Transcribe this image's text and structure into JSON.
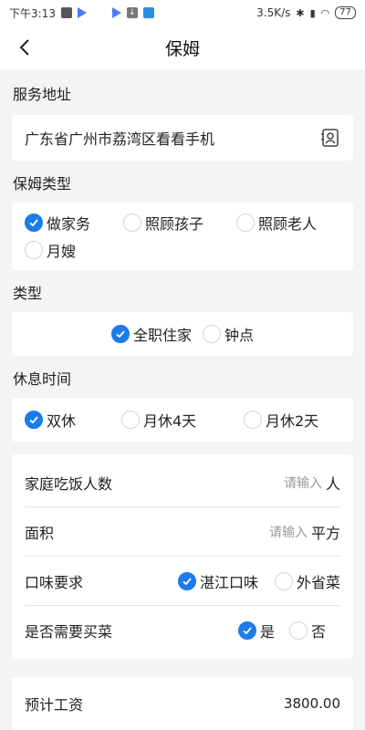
{
  "status": {
    "time": "下午3:13",
    "net_speed": "3.5K/s",
    "battery": "77"
  },
  "nav": {
    "title": "保姆"
  },
  "address": {
    "label": "服务地址",
    "value": "广东省广州市荔湾区看看手机"
  },
  "nanny_type": {
    "label": "保姆类型",
    "options": [
      {
        "text": "做家务",
        "checked": true
      },
      {
        "text": "照顾孩子",
        "checked": false
      },
      {
        "text": "照顾老人",
        "checked": false
      },
      {
        "text": "月嫂",
        "checked": false
      }
    ]
  },
  "type": {
    "label": "类型",
    "options": [
      {
        "text": "全职住家",
        "checked": true
      },
      {
        "text": "钟点",
        "checked": false
      }
    ]
  },
  "rest": {
    "label": "休息时间",
    "options": [
      {
        "text": "双休",
        "checked": true
      },
      {
        "text": "月休4天",
        "checked": false
      },
      {
        "text": "月休2天",
        "checked": false
      }
    ]
  },
  "form": {
    "diners": {
      "label": "家庭吃饭人数",
      "placeholder": "请输入",
      "unit": "人"
    },
    "area": {
      "label": "面积",
      "placeholder": "请输入",
      "unit": "平方"
    },
    "taste": {
      "label": "口味要求",
      "options": [
        {
          "text": "湛江口味",
          "checked": true
        },
        {
          "text": "外省菜",
          "checked": false
        }
      ]
    },
    "groceries": {
      "label": "是否需要买菜",
      "options": [
        {
          "text": "是",
          "checked": true
        },
        {
          "text": "否",
          "checked": false
        }
      ]
    }
  },
  "salary": {
    "label": "预计工资",
    "value": "3800.00"
  },
  "colors": {
    "accent": "#1a7ce8",
    "background": "#f3f4f6"
  }
}
